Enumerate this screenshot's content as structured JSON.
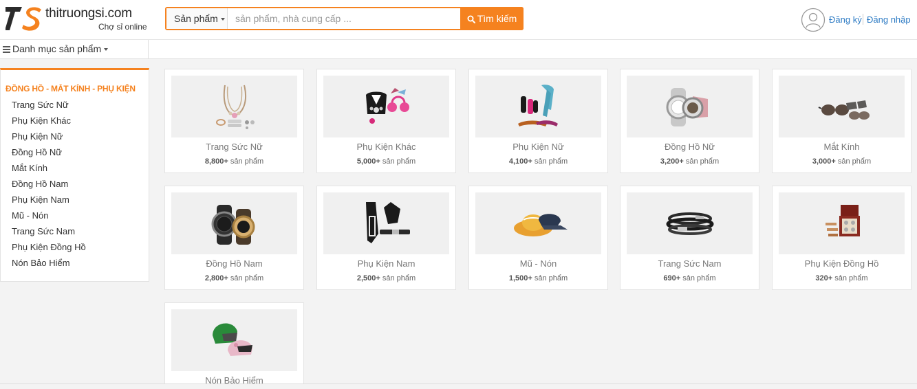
{
  "brand": {
    "name": "thitruongsi.com",
    "tagline": "Chợ sỉ online",
    "accent": "#f5821f"
  },
  "search": {
    "category": "Sản phẩm",
    "placeholder": "sản phẩm, nhà cung cấp ...",
    "value": "",
    "button": "Tìm kiếm"
  },
  "auth": {
    "register": "Đăng ký",
    "login": "Đăng nhập"
  },
  "catbar": {
    "label": "Danh mục sản phẩm"
  },
  "sidebar": {
    "title": "ĐỒNG HỒ - MẮT KÍNH - PHỤ KIỆN",
    "items": [
      "Trang Sức Nữ",
      "Phụ Kiện Khác",
      "Phụ Kiện Nữ",
      "Đồng Hồ Nữ",
      "Mắt Kính",
      "Đồng Hồ Nam",
      "Phụ Kiện Nam",
      "Mũ - Nón",
      "Trang Sức Nam",
      "Phụ Kiện Đồng Hồ",
      "Nón Bảo Hiểm"
    ]
  },
  "products": [
    {
      "name": "Trang Sức Nữ",
      "count": "8,800+",
      "icon": "necklace"
    },
    {
      "name": "Phụ Kiện Khác",
      "count": "5,000+",
      "icon": "collar-earmuffs"
    },
    {
      "name": "Phụ Kiện Nữ",
      "count": "4,100+",
      "icon": "scarf-gloves"
    },
    {
      "name": "Đồng Hồ Nữ",
      "count": "3,200+",
      "icon": "women-watch"
    },
    {
      "name": "Mắt Kính",
      "count": "3,000+",
      "icon": "sunglasses"
    },
    {
      "name": "Đồng Hồ Nam",
      "count": "2,800+",
      "icon": "men-watch"
    },
    {
      "name": "Phụ Kiện Nam",
      "count": "2,500+",
      "icon": "gloves-belt"
    },
    {
      "name": "Mũ - Nón",
      "count": "1,500+",
      "icon": "hats"
    },
    {
      "name": "Trang Sức Nam",
      "count": "690+",
      "icon": "bracelets"
    },
    {
      "name": "Phụ Kiện Đồng Hồ",
      "count": "320+",
      "icon": "watch-box"
    },
    {
      "name": "Nón Bảo Hiểm",
      "count": "",
      "icon": "helmets"
    }
  ],
  "count_suffix": "sản phẩm"
}
